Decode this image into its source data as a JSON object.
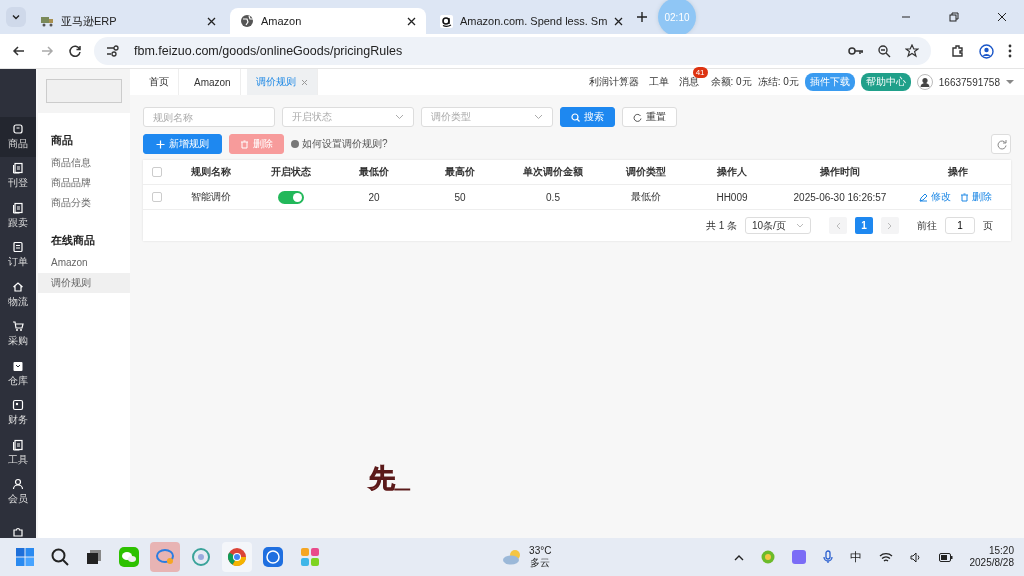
{
  "browser": {
    "tabs": [
      {
        "title": "亚马逊ERP",
        "selected": false
      },
      {
        "title": "Amazon",
        "selected": true
      },
      {
        "title": "Amazon.com. Spend less. Sm",
        "selected": false
      }
    ],
    "timer": "02:10",
    "url": "fbm.feizuo.com/goods/onlineGoods/pricingRules"
  },
  "nav": {
    "items": [
      {
        "label": "商品",
        "selected": true
      },
      {
        "label": "刊登",
        "selected": false
      },
      {
        "label": "跟卖",
        "selected": false
      },
      {
        "label": "订单",
        "selected": false
      },
      {
        "label": "物流",
        "selected": false
      },
      {
        "label": "采购",
        "selected": false
      },
      {
        "label": "仓库",
        "selected": false
      },
      {
        "label": "财务",
        "selected": false
      },
      {
        "label": "工具",
        "selected": false
      },
      {
        "label": "会员",
        "selected": false
      },
      {
        "selected": false
      }
    ]
  },
  "submenu": [
    {
      "heading": "商品",
      "items": [
        {
          "label": "商品信息",
          "selected": false
        },
        {
          "label": "商品品牌",
          "selected": false
        },
        {
          "label": "商品分类",
          "selected": false
        }
      ]
    },
    {
      "heading": "在线商品",
      "items": [
        {
          "label": "Amazon",
          "selected": false
        },
        {
          "label": "调价规则",
          "selected": true
        }
      ]
    }
  ],
  "page_tabs": [
    {
      "label": "首页",
      "selected": false,
      "closable": false
    },
    {
      "label": "Amazon",
      "selected": false,
      "closable": false
    },
    {
      "label": "调价规则",
      "selected": true,
      "closable": true
    }
  ],
  "header": {
    "links": [
      "利润计算器",
      "工单"
    ],
    "messages": {
      "label": "消息",
      "badge": "41"
    },
    "balance": "余额: 0元",
    "frozen": "冻结: 0元",
    "buttons": [
      "插件下载",
      "帮助中心"
    ],
    "user": "16637591758"
  },
  "filters": [
    {
      "placeholder": "规则名称",
      "kind": "input"
    },
    {
      "placeholder": "开启状态",
      "kind": "select"
    },
    {
      "placeholder": "调价类型",
      "kind": "select"
    }
  ],
  "search_button": "搜索",
  "reset_button": "重置",
  "add_button": "新增规则",
  "delete_button": "删除",
  "help_link": "如何设置调价规则?",
  "table": {
    "all_checked": false,
    "columns": [
      "规则名称",
      "开启状态",
      "最低价",
      "最高价",
      "单次调价金额",
      "调价类型",
      "操作人",
      "操作时间",
      "操作"
    ],
    "rows": [
      {
        "checked": false,
        "name": "智能调价",
        "enabled": true,
        "min": "20",
        "max": "50",
        "step": "0.5",
        "type": "最低价",
        "operator": "HH009",
        "time": "2025-06-30 16:26:57",
        "actions": [
          "修改",
          "删除"
        ]
      }
    ]
  },
  "pagination": {
    "total": "共 1 条",
    "page_size": "10条/页",
    "pages": [
      {
        "label": "1",
        "selected": true
      }
    ],
    "goto_label": "前往",
    "goto_value": "1",
    "goto_suffix": "页"
  },
  "caption": "先_",
  "taskbar": {
    "weather_temp": "33°C",
    "weather_text": "多云",
    "ime": "中",
    "time": "15:20",
    "date": "2025/8/28"
  }
}
